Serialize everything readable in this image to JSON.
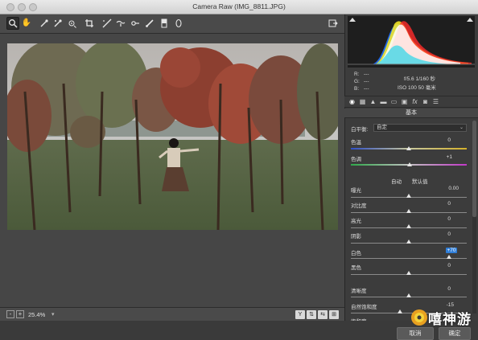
{
  "window": {
    "title": "Camera Raw (IMG_8811.JPG)"
  },
  "toolbar": {
    "tools": [
      {
        "name": "zoom-tool",
        "icon": "magnifier-icon",
        "active": true
      },
      {
        "name": "hand-tool",
        "icon": "hand-icon"
      },
      {
        "name": "white-balance-tool",
        "icon": "eyedropper-icon"
      },
      {
        "name": "color-sampler-tool",
        "icon": "color-sampler-icon"
      },
      {
        "name": "targeted-adjustment-tool",
        "icon": "target-adjust-icon"
      },
      {
        "name": "crop-tool",
        "icon": "crop-icon"
      },
      {
        "name": "straighten-tool",
        "icon": "straighten-icon"
      },
      {
        "name": "spot-removal-tool",
        "icon": "spot-removal-icon"
      },
      {
        "name": "red-eye-tool",
        "icon": "red-eye-icon"
      },
      {
        "name": "adjustment-brush-tool",
        "icon": "brush-icon"
      },
      {
        "name": "graduated-filter-tool",
        "icon": "graduated-filter-icon"
      },
      {
        "name": "radial-filter-tool",
        "icon": "radial-filter-icon"
      }
    ],
    "open_prefs_icon": "open-prefs-icon"
  },
  "histogram": {
    "r_label": "R:",
    "g_label": "G:",
    "b_label": "B:",
    "r_value": "---",
    "g_value": "---",
    "b_value": "---",
    "aperture_shutter": "f/5.6   1/160 秒",
    "iso_focal": "ISO 100   50 毫米"
  },
  "panel_tabs": [
    "basic",
    "tone-curve",
    "detail",
    "hsl",
    "split-toning",
    "lens",
    "fx",
    "camera-calibration",
    "presets"
  ],
  "basic": {
    "section_title": "基本",
    "white_balance_label": "白平衡:",
    "white_balance_value": "自定",
    "temperature_label": "色温",
    "temperature_value": "0",
    "tint_label": "色调",
    "tint_value": "+1",
    "auto_label": "自动",
    "default_label": "默认值",
    "exposure_label": "曝光",
    "exposure_value": "0.00",
    "contrast_label": "对比度",
    "contrast_value": "0",
    "highlights_label": "高光",
    "highlights_value": "0",
    "shadows_label": "阴影",
    "shadows_value": "0",
    "whites_label": "白色",
    "whites_value": "+70",
    "blacks_label": "黑色",
    "blacks_value": "0",
    "clarity_label": "清晰度",
    "clarity_value": "0",
    "vibrance_label": "自然饱和度",
    "vibrance_value": "-15",
    "saturation_label": "饱和度",
    "saturation_value": ""
  },
  "status": {
    "zoom": "25.4%",
    "zoom_minus": "-",
    "zoom_plus": "+",
    "view_y": "Y"
  },
  "buttons": {
    "cancel": "取消",
    "ok": "确定"
  },
  "watermark": {
    "text": "嘻神游"
  },
  "colors": {
    "accent": "#2f7ed8",
    "panel_bg": "#3c3c3c",
    "canvas_bg": "#464646"
  }
}
